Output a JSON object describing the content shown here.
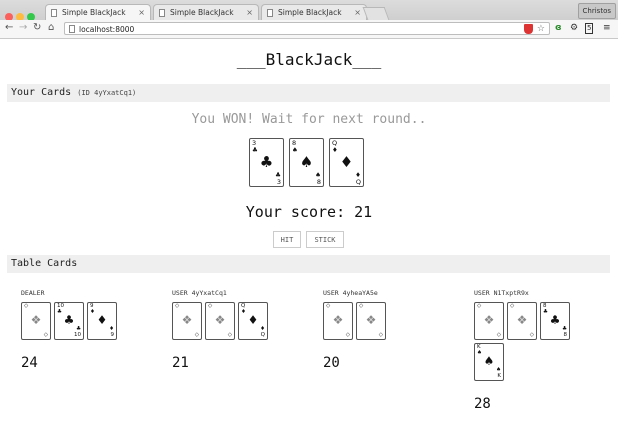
{
  "browser": {
    "tabs": [
      {
        "title": "Simple BlackJack Game"
      },
      {
        "title": "Simple BlackJack Game"
      },
      {
        "title": "Simple BlackJack Game"
      }
    ],
    "profile": "Christos",
    "url": "localhost:8000",
    "colors": {
      "close": "#fc605c",
      "min": "#fdbc40",
      "max": "#34c84a"
    }
  },
  "page": {
    "title": "___BlackJack___",
    "your_cards_label": "Your Cards",
    "your_id": "(ID 4yYxatCq1)",
    "status": "You WON! Wait for next round..",
    "my_cards": [
      {
        "rank": "3",
        "suit": "♣"
      },
      {
        "rank": "8",
        "suit": "♠"
      },
      {
        "rank": "Q",
        "suit": "♦"
      }
    ],
    "score_text": "Your score: 21",
    "hit_label": "HIT",
    "stick_label": "STICK",
    "table_label": "Table Cards"
  },
  "table": [
    {
      "label": "DEALER",
      "total": "24",
      "cards": [
        {
          "back": true
        },
        {
          "rank": "10",
          "suit": "♣"
        },
        {
          "rank": "9",
          "suit": "♦"
        }
      ]
    },
    {
      "label": "USER 4yYxatCq1",
      "total": "21",
      "cards": [
        {
          "back": true
        },
        {
          "back": true
        },
        {
          "rank": "Q",
          "suit": "♦"
        }
      ]
    },
    {
      "label": "USER 4yheaYA5e",
      "total": "20",
      "cards": [
        {
          "back": true
        },
        {
          "back": true
        }
      ]
    },
    {
      "label": "USER N1TxptR9x",
      "total": "28",
      "cards": [
        {
          "back": true
        },
        {
          "back": true
        },
        {
          "rank": "8",
          "suit": "♣"
        },
        {
          "rank": "K",
          "suit": "♠"
        }
      ]
    }
  ]
}
